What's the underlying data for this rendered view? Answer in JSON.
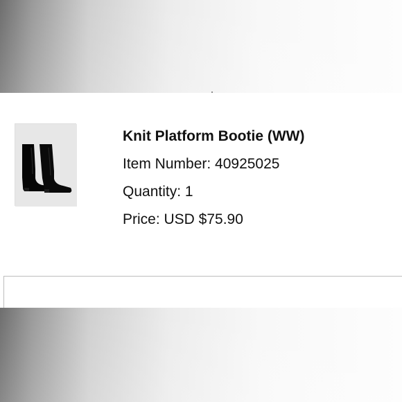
{
  "order_item": {
    "product_name": "Knit Platform Bootie (WW)",
    "item_number_text": "Item Number: 40925025",
    "quantity_text": "Quantity: 1",
    "price_text": "Price: USD $75.90"
  },
  "colors": {
    "text": "#111111",
    "image_bg": "#e7e7e7",
    "divider": "#bdbdbd"
  }
}
